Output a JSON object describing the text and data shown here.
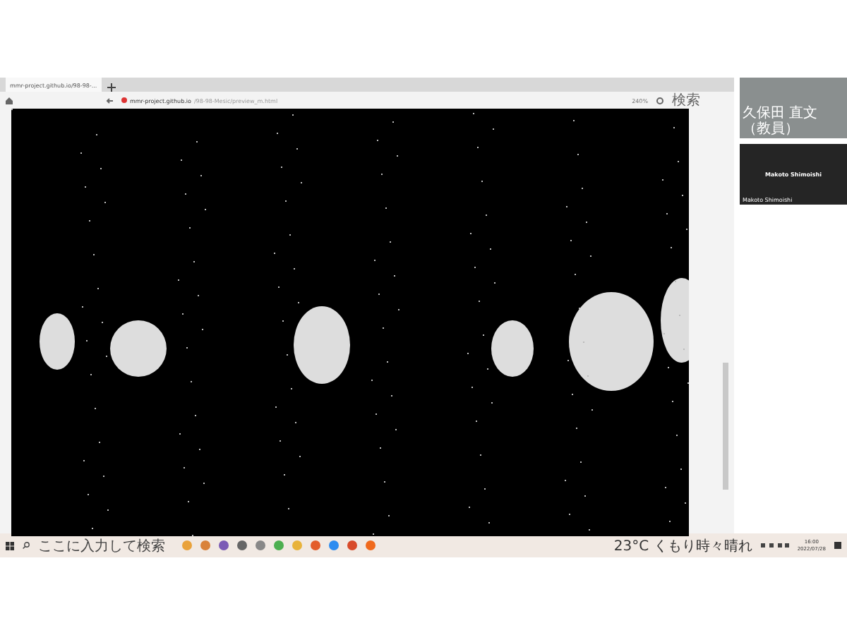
{
  "browser": {
    "tab": {
      "title": "mmr-project.github.io/98-98-...",
      "selected": true
    },
    "address": {
      "domain": "mmr-project.github.io",
      "path": "/98-98-Mesic/preview_m.html"
    },
    "zoom": "240%",
    "search": {
      "placeholder": "検索"
    }
  },
  "meeting": {
    "participants": [
      {
        "kind": "video",
        "caption": "久保田 直文（教員）"
      },
      {
        "kind": "name",
        "name": "Makoto Shimoishi",
        "caption": "Makoto Shimoishi"
      }
    ]
  },
  "taskbar": {
    "search": {
      "placeholder": "ここに入力して検索"
    },
    "weather": "23°C くもり時々晴れ",
    "time": "16:00",
    "date": "2022/07/28"
  }
}
